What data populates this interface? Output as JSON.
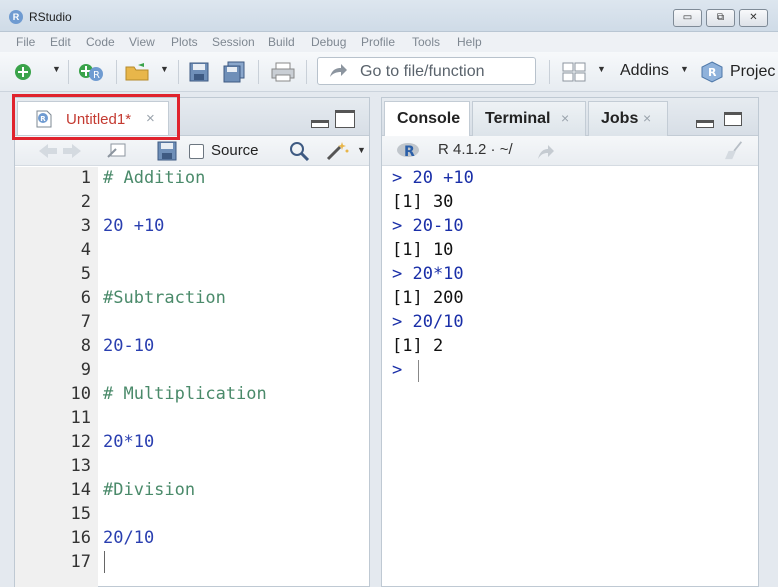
{
  "window": {
    "title": "RStudio",
    "logo_letter": "R",
    "controls": {
      "minimize": "▭",
      "maximize": "⧉",
      "close": "✕"
    }
  },
  "menu": [
    "File",
    "Edit",
    "Code",
    "View",
    "Plots",
    "Session",
    "Build",
    "Debug",
    "Profile",
    "Tools",
    "Help"
  ],
  "toolbar": {
    "goto_placeholder": "Go to file/function",
    "addins_label": "Addins",
    "project_label": "Projec"
  },
  "editor": {
    "tab_name": "Untitled1*",
    "tab_close": "×",
    "source_label": "Source",
    "lines": [
      {
        "no": "1",
        "text": "# Addition",
        "kind": "comment"
      },
      {
        "no": "2",
        "text": "",
        "kind": "num"
      },
      {
        "no": "3",
        "text": "20 +10",
        "kind": "num"
      },
      {
        "no": "4",
        "text": "",
        "kind": "num"
      },
      {
        "no": "5",
        "text": "",
        "kind": "num"
      },
      {
        "no": "6",
        "text": "#Subtraction",
        "kind": "comment"
      },
      {
        "no": "7",
        "text": "",
        "kind": "num"
      },
      {
        "no": "8",
        "text": "20-10",
        "kind": "num"
      },
      {
        "no": "9",
        "text": "",
        "kind": "num"
      },
      {
        "no": "10",
        "text": "# Multiplication",
        "kind": "comment"
      },
      {
        "no": "11",
        "text": "",
        "kind": "num"
      },
      {
        "no": "12",
        "text": "20*10",
        "kind": "num"
      },
      {
        "no": "13",
        "text": "",
        "kind": "num"
      },
      {
        "no": "14",
        "text": "#Division",
        "kind": "comment"
      },
      {
        "no": "15",
        "text": "",
        "kind": "num"
      },
      {
        "no": "16",
        "text": "20/10",
        "kind": "num"
      },
      {
        "no": "17",
        "text": "",
        "kind": "num"
      }
    ]
  },
  "console": {
    "tabs": [
      {
        "label": "Console",
        "close": ""
      },
      {
        "label": "Terminal",
        "close": "×"
      },
      {
        "label": "Jobs",
        "close": "×"
      }
    ],
    "r_version": "R 4.1.2 · ~/",
    "lines": [
      {
        "text": "> 20 +10",
        "kind": "cmd"
      },
      {
        "text": "[1] 30",
        "kind": "out"
      },
      {
        "text": "> 20-10",
        "kind": "cmd"
      },
      {
        "text": "[1] 10",
        "kind": "out"
      },
      {
        "text": "> 20*10",
        "kind": "cmd"
      },
      {
        "text": "[1] 200",
        "kind": "out"
      },
      {
        "text": "> 20/10",
        "kind": "cmd"
      },
      {
        "text": "[1] 2",
        "kind": "out"
      },
      {
        "text": ">",
        "kind": "cmd"
      }
    ]
  },
  "colors": {
    "highlight": "#e0232d",
    "comment": "#4a8a6a",
    "code": "#2a3fb0",
    "tab_modified": "#c43a31"
  }
}
